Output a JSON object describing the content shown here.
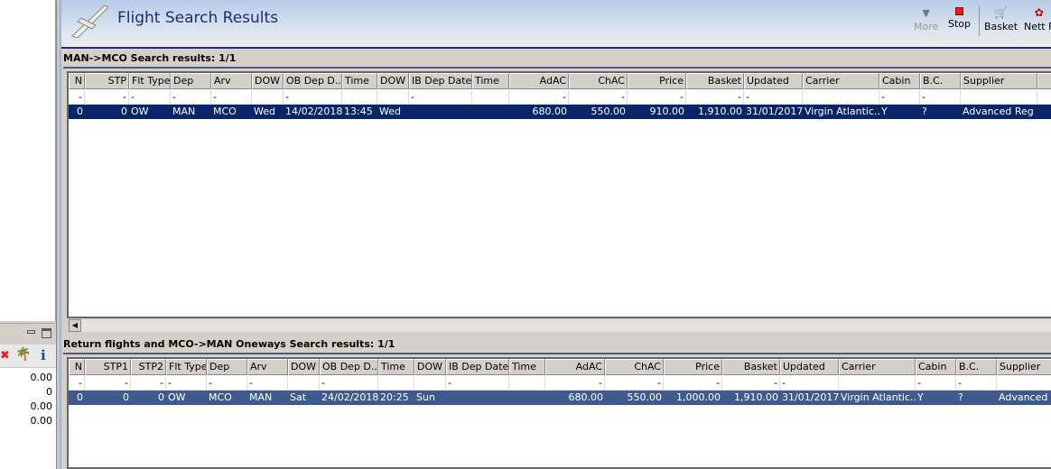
{
  "header": {
    "title": "Flight Search Results"
  },
  "toolbar": {
    "more": "More",
    "stop": "Stop",
    "basket": "Basket",
    "nett": "Nett F"
  },
  "left_panel": {
    "values": [
      "0.00",
      "0",
      "0.00",
      "0.00"
    ]
  },
  "outbound": {
    "title": "MAN->MCO Search results: 1/1",
    "columns": [
      "N",
      "STP",
      "Flt Type",
      "Dep",
      "Arv",
      "DOW",
      "OB Dep D...",
      "Time",
      "DOW",
      "IB Dep Date",
      "Time",
      "AdAC",
      "ChAC",
      "Price",
      "Basket",
      "Updated",
      "Carrier",
      "Cabin",
      "B.C.",
      "Supplier",
      ""
    ],
    "filter": [
      "-",
      "-",
      "-",
      "-",
      "-",
      "",
      "-",
      "",
      "",
      "-",
      "",
      "-",
      "-",
      "-",
      "-",
      "-",
      "",
      "-",
      "-",
      "",
      ""
    ],
    "rows": [
      [
        "0",
        "0",
        "OW",
        "MAN",
        "MCO",
        "Wed",
        "14/02/2018",
        "13:45",
        "Wed",
        "",
        "",
        "680.00",
        "550.00",
        "910.00",
        "1,910.00",
        "31/01/2017",
        "Virgin Atlantic...",
        "Y",
        "?",
        "Advanced Reg",
        ""
      ]
    ]
  },
  "return": {
    "title": "Return flights and MCO->MAN Oneways Search results: 1/1",
    "columns": [
      "N",
      "STP1",
      "STP2",
      "Flt Type",
      "Dep",
      "Arv",
      "DOW",
      "OB Dep D...",
      "Time",
      "DOW",
      "IB Dep Date",
      "Time",
      "AdAC",
      "ChAC",
      "Price",
      "Basket",
      "Updated",
      "Carrier",
      "Cabin",
      "B.C.",
      "Supplier"
    ],
    "filter": [
      "-",
      "-",
      "-",
      "-",
      "-",
      "-",
      "",
      "-",
      "",
      "",
      "-",
      "",
      "-",
      "-",
      "-",
      "-",
      "-",
      "",
      "-",
      "-",
      ""
    ],
    "rows": [
      [
        "0",
        "0",
        "0",
        "OW",
        "MCO",
        "MAN",
        "Sat",
        "24/02/2018",
        "20:25",
        "Sun",
        "",
        "",
        "680.00",
        "550.00",
        "1,000.00",
        "1,910.00",
        "31/01/2017",
        "Virgin Atlantic...",
        "Y",
        "?",
        "Advanced Reg"
      ]
    ]
  },
  "colors": {
    "selected_top": "#0a246a",
    "selected_bottom": "#3f5a8f"
  }
}
